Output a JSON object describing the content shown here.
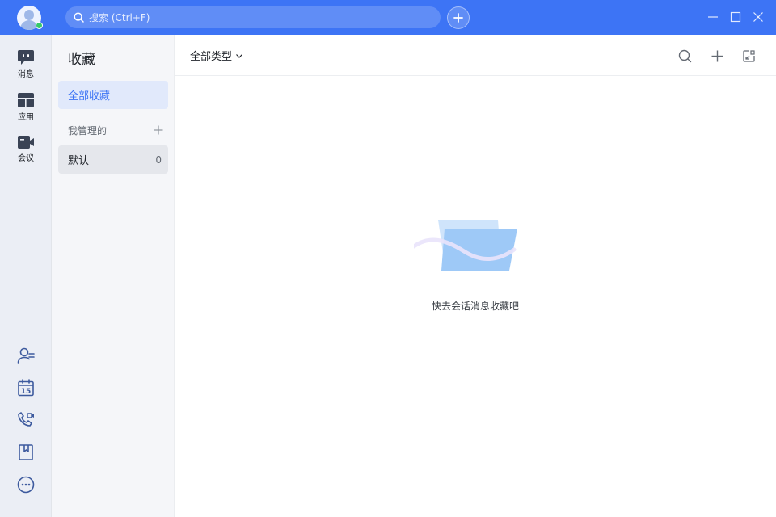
{
  "header": {
    "search_placeholder": "搜索 (Ctrl+F)"
  },
  "rail": {
    "items": [
      {
        "label": "消息",
        "icon": "message-icon"
      },
      {
        "label": "应用",
        "icon": "apps-icon"
      },
      {
        "label": "会议",
        "icon": "meeting-icon"
      }
    ],
    "bottom_icons": [
      "contacts-icon",
      "calendar-icon",
      "call-icon",
      "bookmark-icon",
      "more-icon"
    ],
    "calendar_day": "15"
  },
  "panel": {
    "title": "收藏",
    "all_label": "全部收藏",
    "section_label": "我管理的",
    "default_label": "默认",
    "default_count": "0"
  },
  "main": {
    "type_filter": "全部类型",
    "empty_text": "快去会话消息收藏吧"
  },
  "colors": {
    "accent": "#3d74f5",
    "online": "#36c96a"
  }
}
